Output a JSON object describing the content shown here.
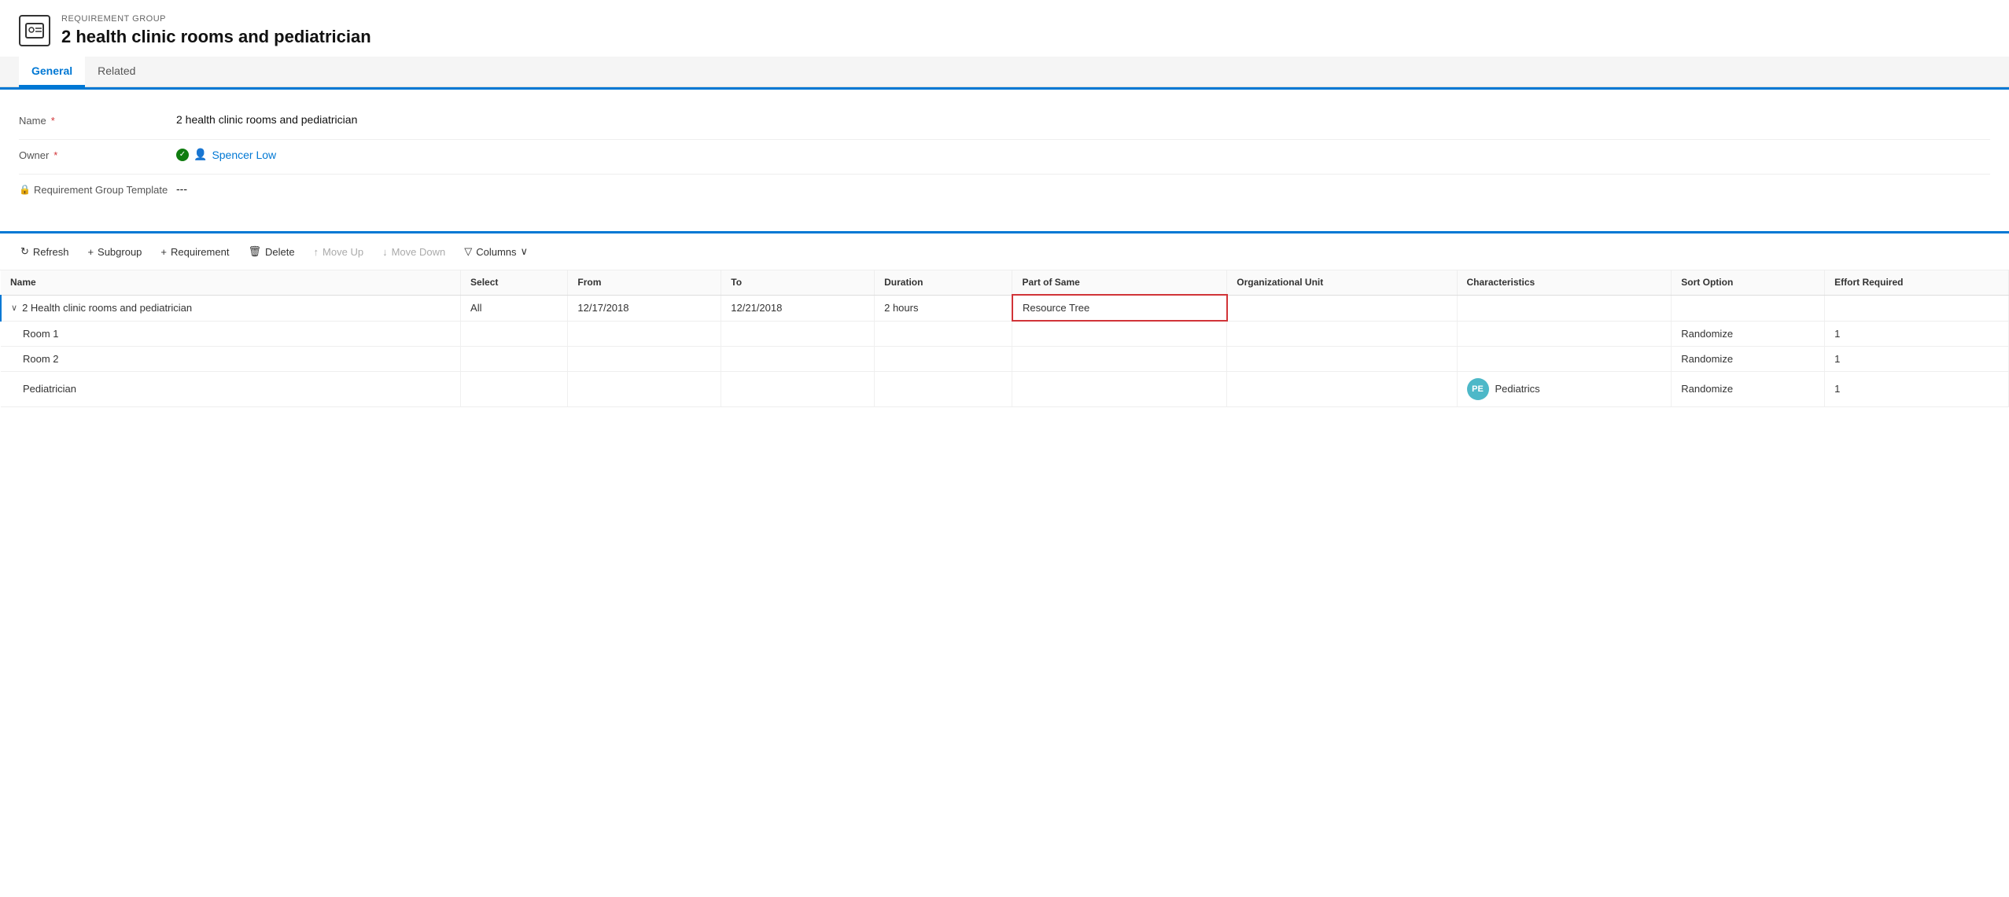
{
  "header": {
    "subtitle": "REQUIREMENT GROUP",
    "title": "2 health clinic rooms and pediatrician",
    "icon_text": "≡"
  },
  "tabs": [
    {
      "id": "general",
      "label": "General",
      "active": true
    },
    {
      "id": "related",
      "label": "Related",
      "active": false
    }
  ],
  "form": {
    "fields": [
      {
        "id": "name",
        "label": "Name",
        "required": true,
        "value": "2 health clinic rooms and pediatrician",
        "type": "text"
      },
      {
        "id": "owner",
        "label": "Owner",
        "required": true,
        "value": "Spencer Low",
        "type": "link"
      },
      {
        "id": "req_group_template",
        "label": "Requirement Group Template",
        "required": false,
        "value": "---",
        "type": "text",
        "has_lock": true
      }
    ]
  },
  "toolbar": {
    "buttons": [
      {
        "id": "refresh",
        "label": "Refresh",
        "icon": "↻",
        "disabled": false
      },
      {
        "id": "subgroup",
        "label": "Subgroup",
        "icon": "+",
        "disabled": false
      },
      {
        "id": "requirement",
        "label": "Requirement",
        "icon": "+",
        "disabled": false
      },
      {
        "id": "delete",
        "label": "Delete",
        "icon": "🗑",
        "disabled": false
      },
      {
        "id": "move-up",
        "label": "Move Up",
        "icon": "↑",
        "disabled": true
      },
      {
        "id": "move-down",
        "label": "Move Down",
        "icon": "↓",
        "disabled": true
      },
      {
        "id": "columns",
        "label": "Columns",
        "icon": "▽",
        "disabled": false
      }
    ]
  },
  "table": {
    "columns": [
      {
        "id": "name",
        "label": "Name"
      },
      {
        "id": "select",
        "label": "Select"
      },
      {
        "id": "from",
        "label": "From"
      },
      {
        "id": "to",
        "label": "To"
      },
      {
        "id": "duration",
        "label": "Duration"
      },
      {
        "id": "part_of_same",
        "label": "Part of Same"
      },
      {
        "id": "org_unit",
        "label": "Organizational Unit"
      },
      {
        "id": "characteristics",
        "label": "Characteristics"
      },
      {
        "id": "sort_option",
        "label": "Sort Option"
      },
      {
        "id": "effort_required",
        "label": "Effort Required"
      }
    ],
    "rows": [
      {
        "id": "row-main",
        "name": "2 Health clinic rooms and pediatrician",
        "indent": 0,
        "has_chevron": true,
        "select": "All",
        "from": "12/17/2018",
        "to": "12/21/2018",
        "duration": "2 hours",
        "part_of_same": "Resource Tree",
        "org_unit": "",
        "characteristics": "",
        "sort_option": "",
        "effort_required": "",
        "highlighted": true,
        "part_highlighted": true
      },
      {
        "id": "row-room1",
        "name": "Room 1",
        "indent": 1,
        "has_chevron": false,
        "select": "",
        "from": "",
        "to": "",
        "duration": "",
        "part_of_same": "",
        "org_unit": "",
        "characteristics": "",
        "sort_option": "Randomize",
        "effort_required": "1"
      },
      {
        "id": "row-room2",
        "name": "Room 2",
        "indent": 1,
        "has_chevron": false,
        "select": "",
        "from": "",
        "to": "",
        "duration": "",
        "part_of_same": "",
        "org_unit": "",
        "characteristics": "",
        "sort_option": "Randomize",
        "effort_required": "1"
      },
      {
        "id": "row-pediatrician",
        "name": "Pediatrician",
        "indent": 1,
        "has_chevron": false,
        "select": "",
        "from": "",
        "to": "",
        "duration": "",
        "part_of_same": "",
        "org_unit": "",
        "avatar": "PE",
        "characteristics": "Pediatrics",
        "sort_option": "Randomize",
        "effort_required": "1"
      }
    ]
  },
  "colors": {
    "accent": "#0078d4",
    "required": "#d13438",
    "highlight_border": "#d13438",
    "success": "#107c10"
  }
}
